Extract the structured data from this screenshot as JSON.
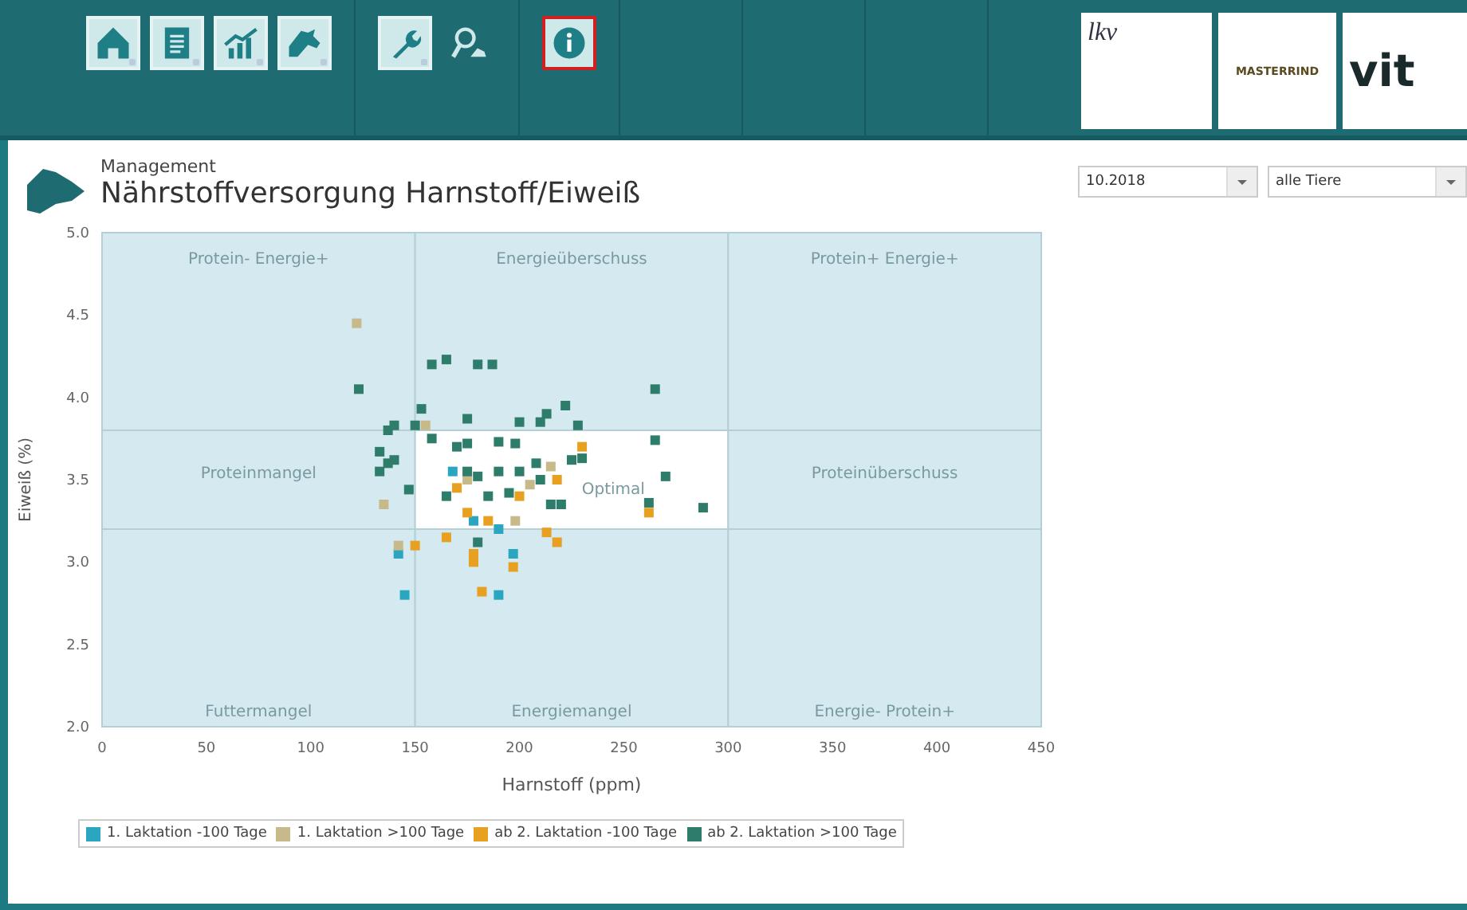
{
  "toolbar": {
    "groups": [
      {
        "buttons": [
          {
            "kind": "house",
            "highlighted": true,
            "has_menu": true,
            "selected": false
          },
          {
            "kind": "document",
            "highlighted": true,
            "has_menu": true,
            "selected": false
          },
          {
            "kind": "chart",
            "highlighted": true,
            "has_menu": true,
            "selected": false
          },
          {
            "kind": "cow",
            "highlighted": true,
            "has_menu": true,
            "selected": false
          }
        ]
      },
      {
        "buttons": [
          {
            "kind": "wrench",
            "highlighted": true,
            "has_menu": true,
            "selected": false
          },
          {
            "kind": "search",
            "highlighted": false,
            "has_menu": false,
            "selected": false
          }
        ]
      },
      {
        "buttons": [
          {
            "kind": "info",
            "highlighted": true,
            "has_menu": false,
            "selected": true
          }
        ]
      }
    ],
    "logos": [
      {
        "kind": "lkv",
        "text": "lkv"
      },
      {
        "kind": "masterrind",
        "text": "MASTERRIND"
      },
      {
        "kind": "vit",
        "text": "vit"
      }
    ]
  },
  "header": {
    "section": "Management",
    "title": "Nährstoffversorgung Harnstoff/Eiweiß"
  },
  "filters": [
    {
      "value": "10.2018"
    },
    {
      "value": "alle Tiere"
    }
  ],
  "chart": {
    "chart_data": {
      "type": "scatter",
      "xlabel": "Harnstoff (ppm)",
      "ylabel": "Eiweiß (%)",
      "xlim": [
        0,
        450
      ],
      "ylim": [
        2.0,
        5.0
      ],
      "xticks": [
        {
          "value": 0,
          "label": "0"
        },
        {
          "value": 50,
          "label": "50"
        },
        {
          "value": 100,
          "label": "100"
        },
        {
          "value": 150,
          "label": "150"
        },
        {
          "value": 200,
          "label": "200"
        },
        {
          "value": 250,
          "label": "250"
        },
        {
          "value": 300,
          "label": "300"
        },
        {
          "value": 350,
          "label": "350"
        },
        {
          "value": 400,
          "label": "400"
        },
        {
          "value": 450,
          "label": "450"
        }
      ],
      "yticks": [
        {
          "value": 2.0,
          "label": "2.0"
        },
        {
          "value": 2.5,
          "label": "2.5"
        },
        {
          "value": 3.0,
          "label": "3.0"
        },
        {
          "value": 3.5,
          "label": "3.5"
        },
        {
          "value": 4.0,
          "label": "4.0"
        },
        {
          "value": 4.5,
          "label": "4.5"
        },
        {
          "value": 5.0,
          "label": "5.0"
        }
      ],
      "annotations": [
        "Protein- Energie+",
        "Energieüberschuss",
        "Protein+ Energie+",
        "Proteinmangel",
        "Optimal",
        "Proteinüberschuss",
        "Futtermangel",
        "Energiemangel",
        "Energie- Protein+"
      ],
      "series": [
        {
          "name": "1. Laktation -100 Tage",
          "color": "#2aa6c0",
          "x": [
            168,
            142,
            145,
            178,
            190,
            197,
            190
          ],
          "values": [
            3.55,
            3.05,
            2.8,
            3.25,
            2.8,
            3.05,
            3.2
          ]
        },
        {
          "name": "1. Laktation >100 Tage",
          "color": "#c8b98a",
          "x": [
            122,
            155,
            135,
            142,
            175,
            205,
            215,
            198
          ],
          "values": [
            4.45,
            3.83,
            3.35,
            3.1,
            3.5,
            3.47,
            3.58,
            3.25
          ]
        },
        {
          "name": "ab 2. Laktation -100 Tage",
          "color": "#e8a020",
          "x": [
            170,
            175,
            185,
            null,
            218,
            230,
            150,
            165,
            178,
            178,
            197,
            182,
            213,
            218,
            262,
            200
          ],
          "values": [
            3.45,
            3.3,
            3.25,
            null,
            3.5,
            3.7,
            3.1,
            3.15,
            3.05,
            3.0,
            2.97,
            2.82,
            3.18,
            3.12,
            3.3,
            3.4
          ]
        },
        {
          "name": "ab 2. Laktation >100 Tage",
          "color": "#2e7d6b",
          "x": [
            123,
            158,
            165,
            180,
            187,
            153,
            175,
            200,
            210,
            213,
            222,
            228,
            265,
            140,
            137,
            150,
            133,
            137,
            140,
            158,
            170,
            175,
            190,
            198,
            208,
            225,
            230,
            265,
            270,
            175,
            180,
            190,
            200,
            210,
            165,
            185,
            195,
            215,
            220,
            262,
            288,
            180,
            147,
            133
          ],
          "values": [
            4.05,
            4.2,
            4.23,
            4.2,
            4.2,
            3.93,
            3.87,
            3.85,
            3.85,
            3.9,
            3.95,
            3.83,
            4.05,
            3.83,
            3.8,
            3.83,
            3.67,
            3.6,
            3.62,
            3.75,
            3.7,
            3.72,
            3.73,
            3.72,
            3.6,
            3.62,
            3.63,
            3.74,
            3.52,
            3.55,
            3.52,
            3.55,
            3.55,
            3.5,
            3.4,
            3.4,
            3.42,
            3.35,
            3.35,
            3.36,
            3.33,
            3.12,
            3.44,
            3.55
          ]
        }
      ]
    }
  }
}
